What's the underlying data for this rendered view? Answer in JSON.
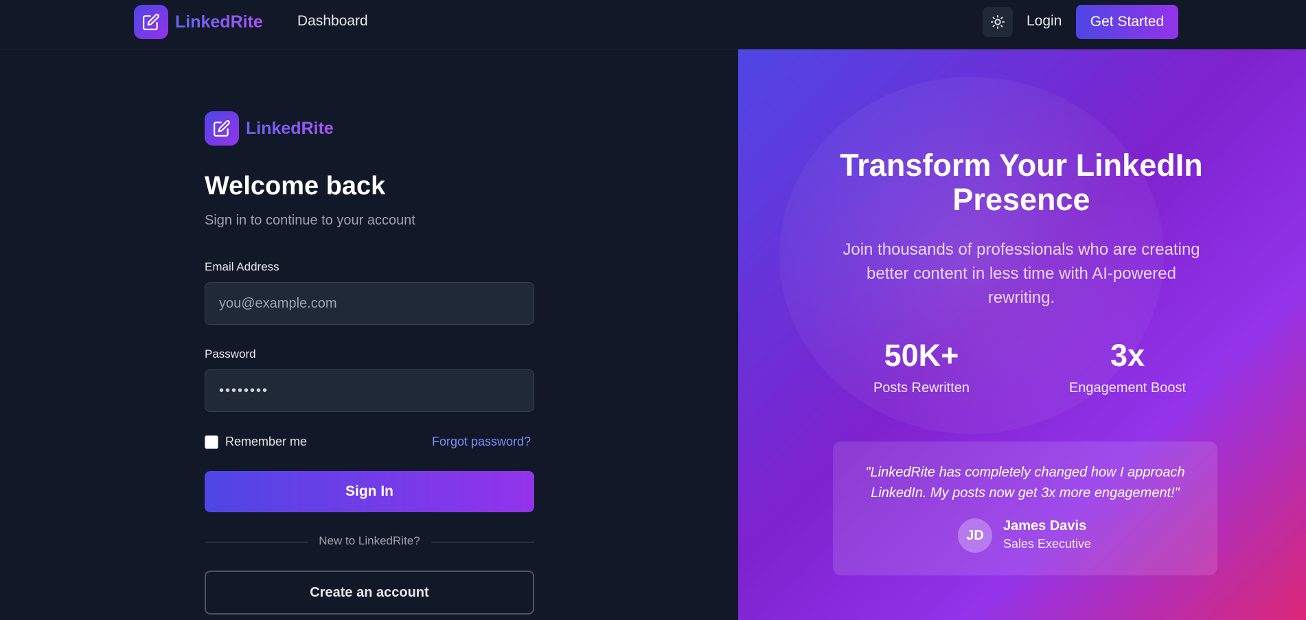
{
  "nav": {
    "brand": "LinkedRite",
    "dashboard": "Dashboard",
    "login": "Login",
    "get_started": "Get Started"
  },
  "form": {
    "brand": "LinkedRite",
    "title": "Welcome back",
    "subtitle": "Sign in to continue to your account",
    "email_label": "Email Address",
    "email_placeholder": "you@example.com",
    "password_label": "Password",
    "password_value": "••••••••",
    "remember_label": "Remember me",
    "forgot_label": "Forgot password?",
    "signin_label": "Sign In",
    "divider_text": "New to LinkedRite?",
    "create_label": "Create an account"
  },
  "promo": {
    "title": "Transform Your LinkedIn Presence",
    "subtitle": "Join thousands of professionals who are creating better content in less time with AI-powered rewriting.",
    "stats": [
      {
        "value": "50K+",
        "label": "Posts Rewritten"
      },
      {
        "value": "3x",
        "label": "Engagement Boost"
      }
    ],
    "testimonial": {
      "quote": "\"LinkedRite has completely changed how I approach LinkedIn. My posts now get 3x more engagement!\"",
      "initials": "JD",
      "name": "James Davis",
      "role": "Sales Executive"
    }
  },
  "colors": {
    "background": "#111827",
    "accent_start": "#4f46e5",
    "accent_end": "#9333ea",
    "link": "#818cf8"
  }
}
